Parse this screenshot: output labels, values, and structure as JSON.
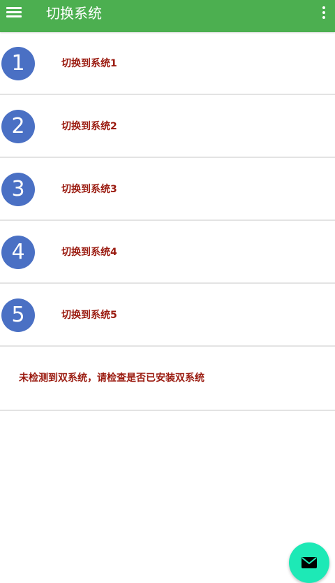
{
  "appbar": {
    "title": "切换系统",
    "color": "#4caf50"
  },
  "icons": {
    "menu": "hamburger-menu-icon",
    "overflow": "more-vert-icon",
    "fab": "mail-icon"
  },
  "list": {
    "items": [
      {
        "number": "1",
        "label": "切换到系统1"
      },
      {
        "number": "2",
        "label": "切换到系统2"
      },
      {
        "number": "3",
        "label": "切换到系统3"
      },
      {
        "number": "4",
        "label": "切换到系统4"
      },
      {
        "number": "5",
        "label": "切换到系统5"
      }
    ],
    "badge_color": "#4a70c4",
    "label_color": "#9a1a0f"
  },
  "status": {
    "message": "未检测到双系统，请检查是否已安装双系统"
  },
  "fab": {
    "color": "#1de9b6"
  }
}
